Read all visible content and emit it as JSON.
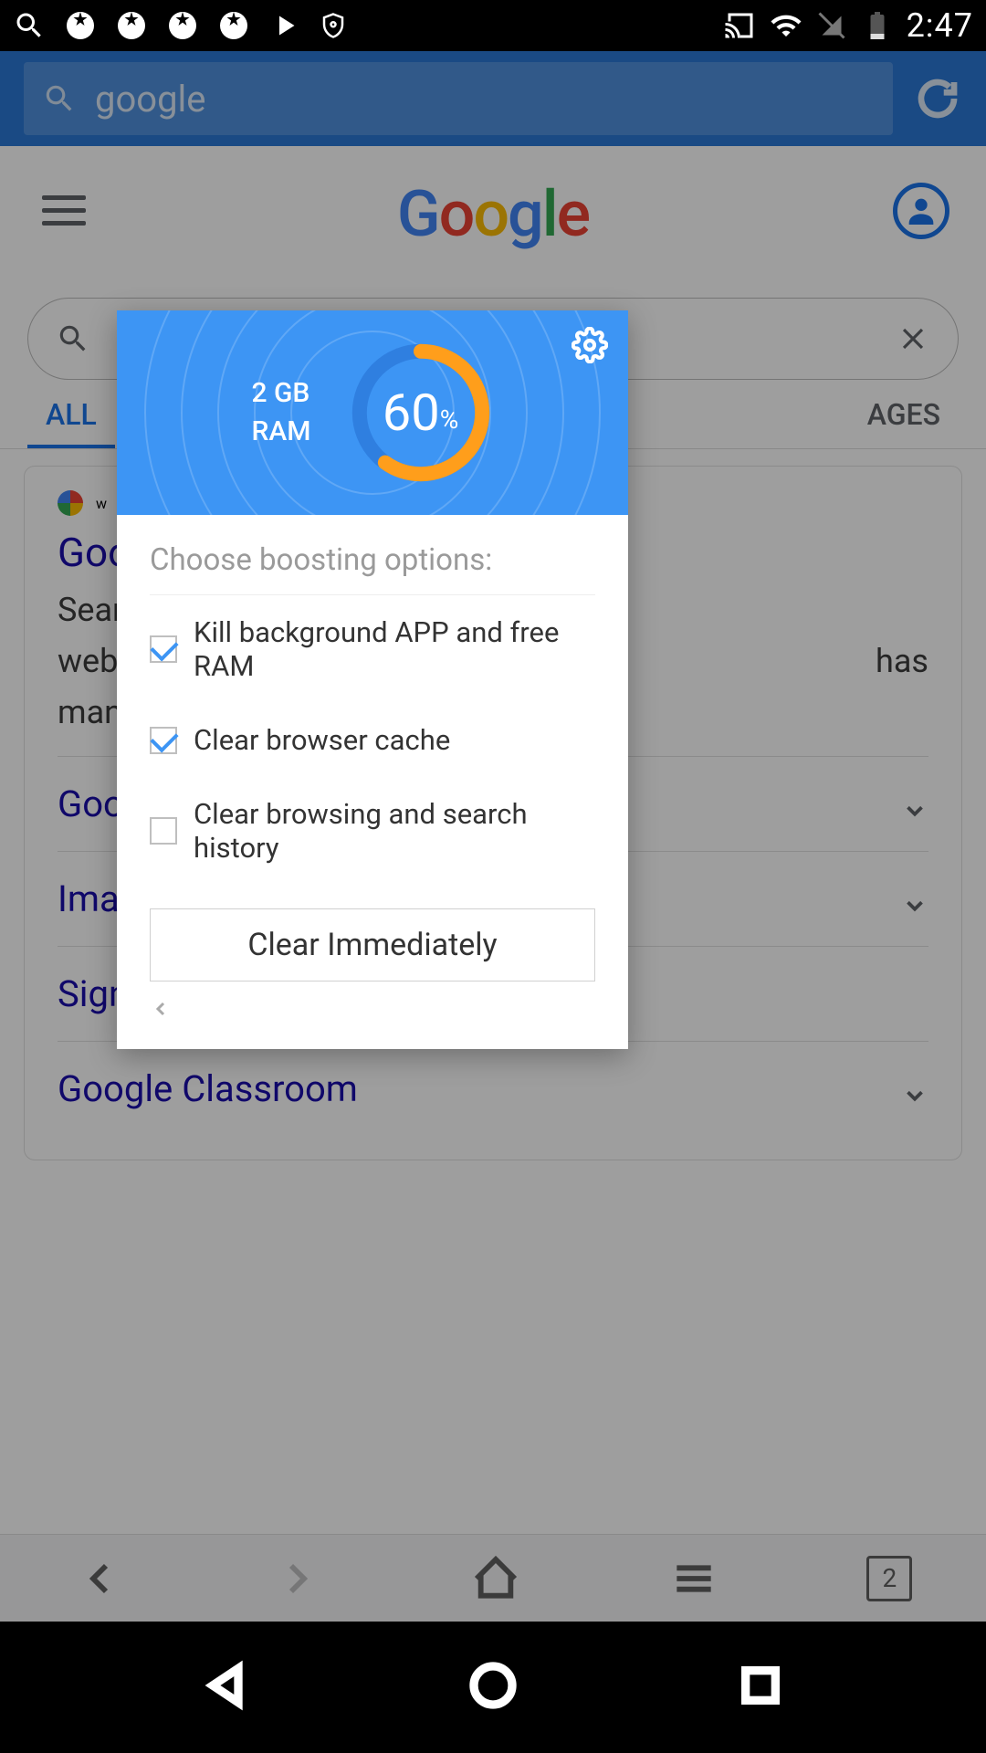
{
  "status": {
    "time": "2:47"
  },
  "browser": {
    "url_text": "google",
    "tab_count": "2"
  },
  "google": {
    "logo_letters": [
      "G",
      "o",
      "o",
      "g",
      "l",
      "e"
    ],
    "tabs": {
      "all": "ALL",
      "right": "AGES"
    },
    "result": {
      "site_label": "w",
      "title": "Goo",
      "desc_part1": "Searc",
      "desc_part2": "webp",
      "desc_part3": "has",
      "desc_part4": "many"
    },
    "sitelinks": [
      "Goog",
      "Imag",
      "Sign in",
      "Google Classroom"
    ]
  },
  "modal": {
    "ram_size": "2 GB",
    "ram_label": "RAM",
    "percent_value": "60",
    "percent_symbol": "%",
    "heading": "Choose boosting options:",
    "options": [
      {
        "label": "Kill background APP and free RAM",
        "checked": true
      },
      {
        "label": "Clear browser cache",
        "checked": true
      },
      {
        "label": "Clear browsing and search history",
        "checked": false
      }
    ],
    "clear_button": "Clear Immediately"
  }
}
